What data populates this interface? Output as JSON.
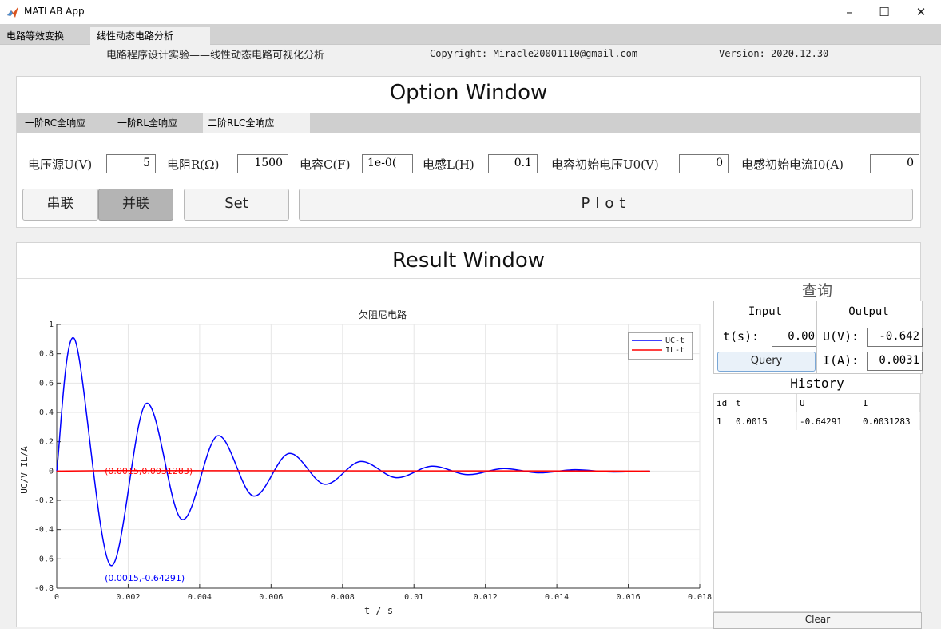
{
  "window": {
    "title": "MATLAB App",
    "minimize": "–",
    "maximize": "☐",
    "close": "✕"
  },
  "tabs": [
    {
      "label": "电路等效变换"
    },
    {
      "label": "线性动态电路分析"
    }
  ],
  "info": {
    "heading": "电路程序设计实验——线性动态电路可视化分析",
    "copyright": "Copyright: Miracle20001110@gmail.com",
    "version": "Version: 2020.12.30"
  },
  "option": {
    "title": "Option Window",
    "subtabs": [
      {
        "label": "一阶RC全响应"
      },
      {
        "label": "一阶RL全响应"
      },
      {
        "label": "二阶RLC全响应"
      }
    ],
    "fields": {
      "voltage": {
        "label": "电压源U(V)",
        "value": "5"
      },
      "resistance": {
        "label": "电阻R(Ω)",
        "value": "1500"
      },
      "capacitance": {
        "label": "电容C(F)",
        "value": "1e-0("
      },
      "inductance": {
        "label": "电感L(H)",
        "value": "0.1"
      },
      "u0": {
        "label": "电容初始电压U0(V)",
        "value": "0"
      },
      "i0": {
        "label": "电感初始电流I0(A)",
        "value": "0"
      }
    },
    "buttons": {
      "series": "串联",
      "parallel": "并联",
      "set": "Set",
      "plot": "Plot"
    }
  },
  "result": {
    "title": "Result Window",
    "query": {
      "title": "查询",
      "input_header": "Input",
      "output_header": "Output",
      "t_label": "t(s):",
      "t_value": "0.00",
      "u_label": "U(V):",
      "u_value": "-0.642",
      "i_label": "I(A):",
      "i_value": "0.0031",
      "button": "Query"
    },
    "history": {
      "title": "History",
      "columns": [
        "id",
        "t",
        "U",
        "I"
      ],
      "rows": [
        [
          "1",
          "0.0015",
          "-0.64291",
          "0.0031283"
        ]
      ],
      "clear": "Clear"
    }
  },
  "chart_data": {
    "type": "line",
    "title": "欠阻尼电路",
    "xlabel": "t / s",
    "ylabel": "UC/V  IL/A",
    "xlim": [
      0,
      0.018
    ],
    "ylim": [
      -0.8,
      1
    ],
    "xticks": [
      "0",
      "0.002",
      "0.004",
      "0.006",
      "0.008",
      "0.01",
      "0.012",
      "0.014",
      "0.016",
      "0.018"
    ],
    "yticks": [
      "1",
      "0.8",
      "0.6",
      "0.4",
      "0.2",
      "0",
      "-0.2",
      "-0.4",
      "-0.6",
      "-0.8"
    ],
    "grid": true,
    "legend_position": "top-right",
    "series": [
      {
        "name": "UC-t",
        "color": "#0000ff",
        "x": [
          0,
          0.0005,
          0.0015,
          0.0025,
          0.0035,
          0.0045,
          0.0055,
          0.0065,
          0.0075,
          0.0085,
          0.0095,
          0.0105,
          0.0115,
          0.0125,
          0.0135,
          0.0145,
          0.0155,
          0.0166
        ],
        "y": [
          0,
          0.9,
          -0.64291,
          0.46,
          -0.33,
          0.24,
          -0.17,
          0.12,
          -0.09,
          0.065,
          -0.045,
          0.033,
          -0.024,
          0.017,
          -0.012,
          0.009,
          -0.006,
          0
        ]
      },
      {
        "name": "IL-t",
        "color": "#ff0000",
        "x": [
          0,
          0.0015,
          0.0166
        ],
        "y": [
          0,
          0.0031283,
          0
        ]
      }
    ],
    "annotations": [
      {
        "text": "(0.0015,0.0031283)",
        "x": 0.0015,
        "y": 0.0031283,
        "color": "#ff0000"
      },
      {
        "text": "(0.0015,-0.64291)",
        "x": 0.0015,
        "y": -0.64291,
        "color": "#0000ff"
      }
    ]
  }
}
